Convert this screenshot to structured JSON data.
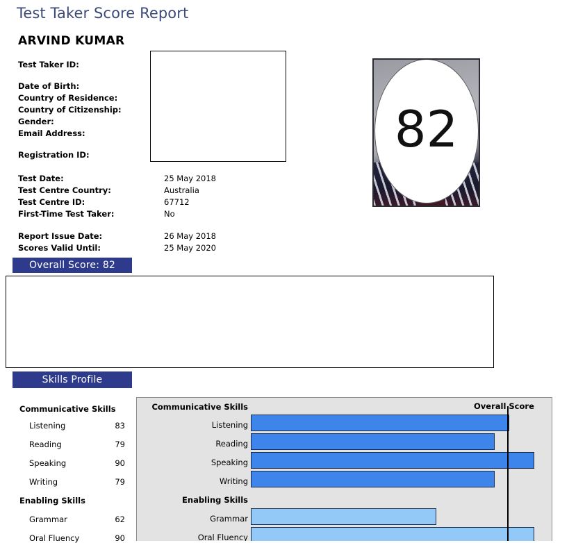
{
  "page_title": "Test Taker Score Report",
  "candidate": {
    "name": "ARVIND KUMAR",
    "identity_fields": [
      {
        "label": "Test Taker ID:",
        "value": ""
      },
      {
        "label": "Date of Birth:",
        "value": ""
      },
      {
        "label": "Country of Residence:",
        "value": ""
      },
      {
        "label": "Country of Citizenship:",
        "value": ""
      },
      {
        "label": "Gender:",
        "value": ""
      },
      {
        "label": "Email Address:",
        "value": ""
      },
      {
        "label": "Registration ID:",
        "value": ""
      }
    ],
    "test_fields": [
      {
        "label": "Test Date:",
        "value": "25 May 2018"
      },
      {
        "label": "Test Centre Country:",
        "value": "Australia"
      },
      {
        "label": "Test Centre ID:",
        "value": "67712"
      },
      {
        "label": "First-Time Test Taker:",
        "value": "No"
      },
      {
        "label": "Report Issue Date:",
        "value": "26 May 2018"
      },
      {
        "label": "Scores Valid Until:",
        "value": "25 May 2020"
      }
    ]
  },
  "photo": {
    "score_value": "82"
  },
  "banners": {
    "overall_score": "Overall Score: 82",
    "skills_profile": "Skills Profile"
  },
  "skills": {
    "communicative_header": "Communicative Skills",
    "enabling_header": "Enabling Skills",
    "overall_score_label": "Overall Score",
    "rows": [
      {
        "label": "Listening",
        "score": "83"
      },
      {
        "label": "Reading",
        "score": "79"
      },
      {
        "label": "Speaking",
        "score": "90"
      },
      {
        "label": "Writing",
        "score": "79"
      },
      {
        "label": "Grammar",
        "score": "62"
      },
      {
        "label": "Oral Fluency",
        "score": "90"
      }
    ]
  },
  "colors": {
    "title_blue": "#3d4a78",
    "banner_navy": "#2e3a8c",
    "bar_communicative": "#3d85eb",
    "bar_enabling": "#93c9f7",
    "chart_background": "#e3e3e3"
  },
  "chart_data": {
    "type": "bar",
    "orientation": "horizontal",
    "title": "Skills Profile",
    "xlabel": "",
    "ylabel": "",
    "xlim": [
      10,
      90
    ],
    "grid": false,
    "reference_line": {
      "label": "Overall Score",
      "value": 82
    },
    "groups": [
      {
        "name": "Communicative Skills",
        "color": "#3d85eb",
        "categories": [
          "Listening",
          "Reading",
          "Speaking",
          "Writing"
        ],
        "values": [
          83,
          79,
          90,
          79
        ]
      },
      {
        "name": "Enabling Skills",
        "color": "#93c9f7",
        "categories": [
          "Grammar",
          "Oral Fluency"
        ],
        "values": [
          62,
          90
        ]
      }
    ],
    "categories": [
      "Listening",
      "Reading",
      "Speaking",
      "Writing",
      "Grammar",
      "Oral Fluency"
    ],
    "values": [
      83,
      79,
      90,
      79,
      62,
      90
    ]
  }
}
